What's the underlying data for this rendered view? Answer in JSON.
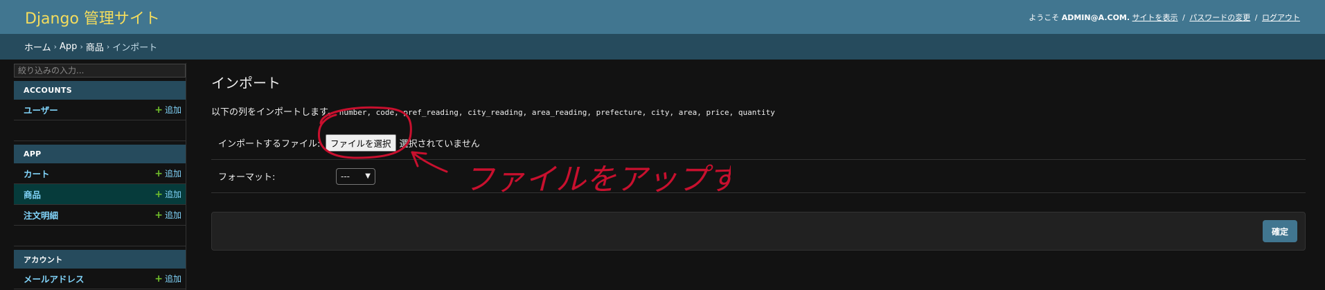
{
  "header": {
    "brand": "Django 管理サイト",
    "welcome": "ようこそ",
    "username": "ADMIN@A.COM.",
    "links": [
      "サイトを表示",
      "パスワードの変更",
      "ログアウト"
    ],
    "separator": "/"
  },
  "breadcrumbs": {
    "items": [
      "ホーム",
      "App",
      "商品"
    ],
    "current": "インポート",
    "separator": "›"
  },
  "sidebar": {
    "filter_placeholder": "絞り込みの入力...",
    "modules": [
      {
        "caption": "ACCOUNTS",
        "models": [
          {
            "name": "ユーザー",
            "add": "追加",
            "active": false
          }
        ]
      },
      {
        "caption": "APP",
        "models": [
          {
            "name": "カート",
            "add": "追加",
            "active": false
          },
          {
            "name": "商品",
            "add": "追加",
            "active": true
          },
          {
            "name": "注文明細",
            "add": "追加",
            "active": false
          }
        ]
      },
      {
        "caption": "アカウント",
        "models": [
          {
            "name": "メールアドレス",
            "add": "追加",
            "active": false
          }
        ]
      }
    ]
  },
  "main": {
    "title": "インポート",
    "help_text": "以下の列をインポートします。",
    "columns": "number, code, pref_reading, city_reading, area_reading, prefecture, city, area, price, quantity",
    "file_label": "インポートするファイル:",
    "file_button": "ファイルを選択",
    "file_status": "選択されていません",
    "format_label": "フォーマット:",
    "format_selected": "---",
    "submit_label": "確定"
  },
  "annotation": {
    "text": "ファイルをアップする",
    "color": "#c8102e"
  },
  "colors": {
    "header_bg": "#417690",
    "breadcrumb_bg": "#264b5d",
    "brand": "#f5dd5d",
    "link": "#81d4fa",
    "add_plus": "#70bf2b",
    "active_row": "#063b3b",
    "page_bg": "#121212"
  }
}
